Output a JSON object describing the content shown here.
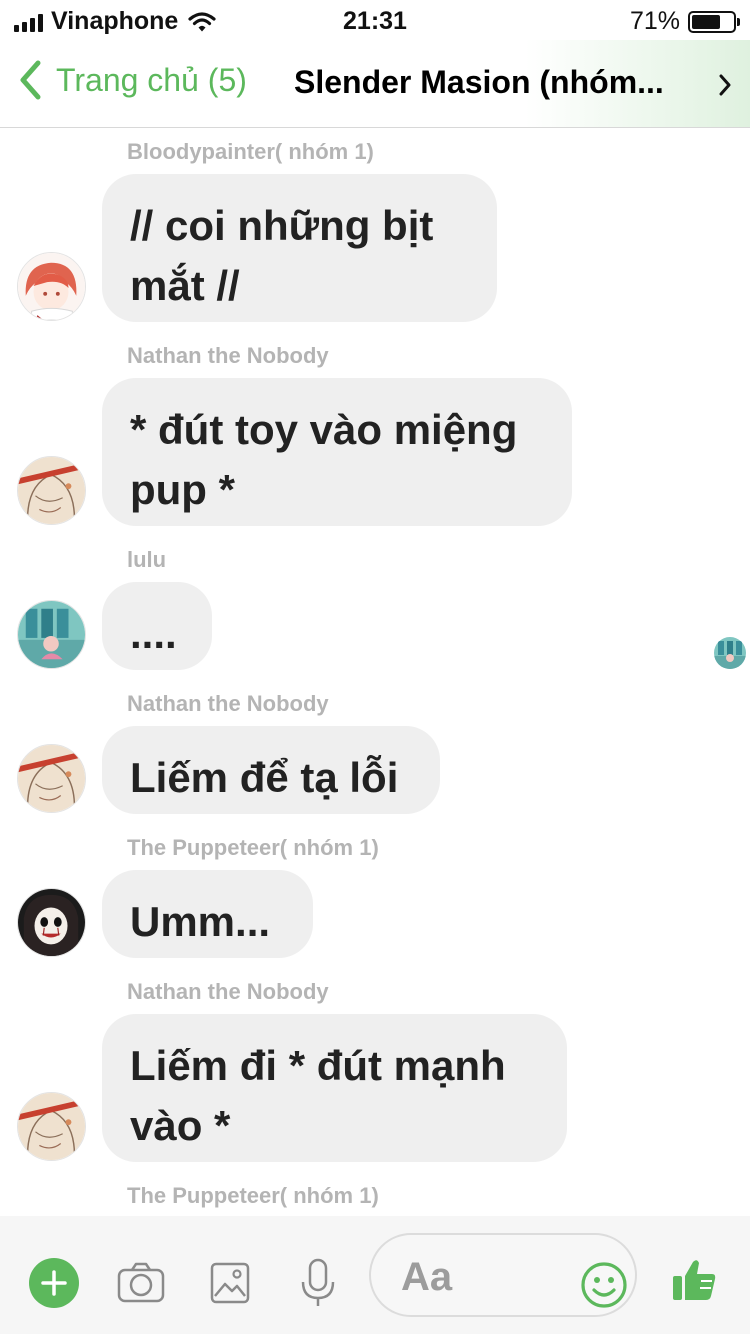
{
  "status_bar": {
    "carrier": "Vinaphone",
    "time": "21:31",
    "battery_percent": "71%",
    "battery_level": 0.71
  },
  "nav": {
    "back_label": "Trang chủ (5)",
    "title": "Slender Masion (nhóm...",
    "accent_color": "#5cb85c"
  },
  "messages": [
    {
      "sender": "Bloodypainter( nhóm 1)",
      "text": "// coi  những bịt mắt //",
      "avatar": "red-hair-avatar-icon"
    },
    {
      "sender": "Nathan the Nobody",
      "text": "* đút toy vào miệng pup *",
      "avatar": "sketch-avatar-icon"
    },
    {
      "sender": "lulu",
      "text": "....",
      "avatar": "teal-room-avatar-icon"
    },
    {
      "sender": "Nathan the Nobody",
      "text": "Liếm để tạ lỗi",
      "avatar": "sketch-avatar-icon"
    },
    {
      "sender": "The Puppeteer(  nhóm 1)",
      "text": "Umm...",
      "avatar": "puppet-mask-avatar-icon"
    },
    {
      "sender": "Nathan the Nobody",
      "text": "Liếm đi  * đút mạnh vào *",
      "avatar": "sketch-avatar-icon"
    },
    {
      "sender": "The Puppeteer(  nhóm 1)"
    }
  ],
  "composer": {
    "placeholder": "Aa",
    "icons": [
      "plus-icon",
      "camera-icon",
      "image-icon",
      "microphone-icon",
      "emoji-icon",
      "thumbs-up-icon"
    ]
  },
  "colors": {
    "bubble": "#efefef",
    "sender": "#b4b4b4",
    "accent": "#5cb85c"
  }
}
